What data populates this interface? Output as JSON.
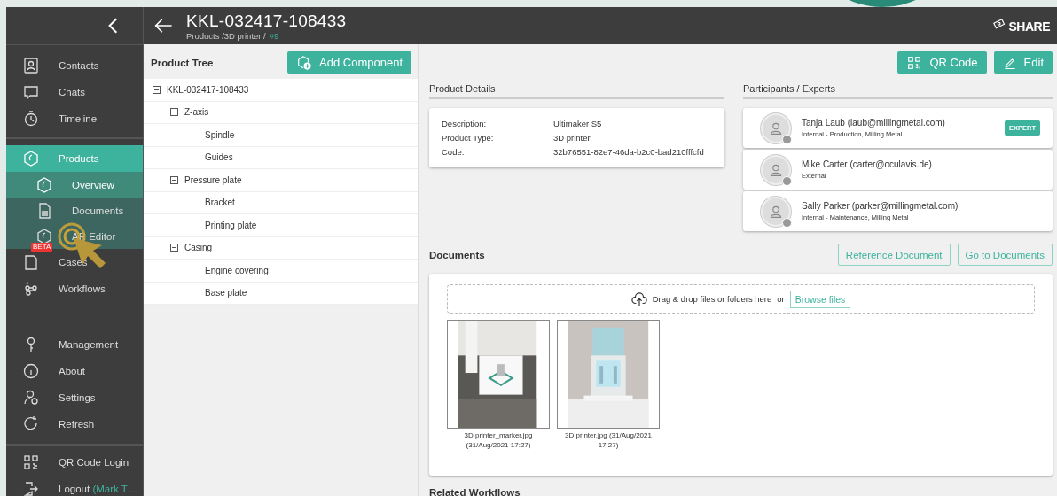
{
  "sidebar": {
    "groups": [
      {
        "items": [
          {
            "label": "Contacts",
            "selected": false
          },
          {
            "label": "Chats",
            "selected": false
          },
          {
            "label": "Timeline",
            "selected": false
          }
        ]
      },
      {
        "items": [
          {
            "label": "Products",
            "selected": true,
            "expanded": true,
            "children": [
              {
                "label": "Overview",
                "selected": true
              },
              {
                "label": "Documents",
                "selected": false
              },
              {
                "label": "AR Editor",
                "selected": false,
                "badge": "BETA"
              }
            ]
          },
          {
            "label": "Cases",
            "selected": false
          },
          {
            "label": "Workflows",
            "selected": false
          }
        ]
      },
      {
        "items": [
          {
            "label": "Management",
            "selected": false
          },
          {
            "label": "About",
            "selected": false
          },
          {
            "label": "Settings",
            "selected": false
          },
          {
            "label": "Refresh",
            "selected": false
          }
        ]
      },
      {
        "items": [
          {
            "label": "QR Code Login",
            "selected": false
          },
          {
            "label": "Logout",
            "selected": false,
            "user": "(Mark T…"
          }
        ]
      }
    ]
  },
  "header": {
    "title": "KKL-032417-108433",
    "breadcrumb": "Products /3D printer /",
    "breadcrumb_link": "#9",
    "logo_text": "SHARE"
  },
  "product_tree": {
    "title": "Product Tree",
    "add_button": "Add Component",
    "nodes": [
      {
        "label": "KKL-032417-108433",
        "expanded": true,
        "children": [
          {
            "label": "Z-axis",
            "expanded": true,
            "children": [
              {
                "label": "Spindle"
              },
              {
                "label": "Guides"
              }
            ]
          },
          {
            "label": "Pressure plate",
            "expanded": true,
            "children": [
              {
                "label": "Bracket"
              },
              {
                "label": "Printing plate"
              }
            ]
          },
          {
            "label": "Casing",
            "expanded": true,
            "children": [
              {
                "label": "Engine covering"
              },
              {
                "label": "Base plate"
              }
            ]
          }
        ]
      }
    ]
  },
  "toolbar": {
    "buttons": [
      "QR Code",
      "Edit"
    ]
  },
  "product_details": {
    "title": "Product Details",
    "fields": [
      {
        "label": "Description:",
        "value": "Ultimaker S5"
      },
      {
        "label": "Product Type:",
        "value": "3D printer"
      },
      {
        "label": "Code:",
        "value": "32b76551-82e7-46da-b2c0-bad210fffcfd"
      }
    ]
  },
  "participants": {
    "title": "Participants / Experts",
    "people": [
      {
        "name": "Tanja Laub (laub@millingmetal.com)",
        "detail": "Internal - Production, Milling Metal",
        "badge": "EXPERT"
      },
      {
        "name": "Mike Carter (carter@oculavis.de)",
        "detail": "External"
      },
      {
        "name": "Sally Parker (parker@millingmetal.com)",
        "detail": "Internal - Maintenance, Milling Metal"
      }
    ]
  },
  "documents": {
    "title": "Documents",
    "buttons": [
      "Reference Document",
      "Go to Documents"
    ],
    "drop_text": "Drag & drop files or folders here",
    "drop_or": "or",
    "browse_button": "Browse files",
    "files": [
      {
        "kind": "picture",
        "caption": "3D printer_marker.jpg (31/Aug/2021 17:27)"
      },
      {
        "kind": "picture",
        "caption": "3D printer.jpg (31/Aug/2021 17:27)"
      }
    ]
  },
  "related_workflows": {
    "title": "Related Workflows"
  }
}
